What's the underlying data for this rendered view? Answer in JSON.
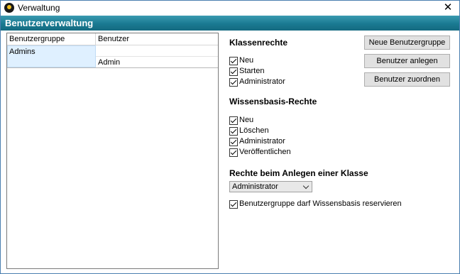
{
  "window": {
    "title": "Verwaltung",
    "close_glyph": "✕"
  },
  "header": {
    "title": "Benutzerverwaltung"
  },
  "tree": {
    "columns": [
      "Benutzergruppe",
      "Benutzer"
    ],
    "group": "Admins",
    "user": "Admin"
  },
  "klassenrechte": {
    "heading": "Klassenrechte",
    "items": [
      {
        "label": "Neu",
        "checked": true
      },
      {
        "label": "Starten",
        "checked": true
      },
      {
        "label": "Administrator",
        "checked": true
      }
    ]
  },
  "wissensbasis": {
    "heading": "Wissensbasis-Rechte",
    "items": [
      {
        "label": "Neu",
        "checked": true
      },
      {
        "label": "Löschen",
        "checked": true
      },
      {
        "label": "Administrator",
        "checked": true
      },
      {
        "label": "Veröffentlichen",
        "checked": true
      }
    ]
  },
  "anlegen": {
    "heading": "Rechte beim Anlegen einer Klasse",
    "selected": "Administrator"
  },
  "reservieren": {
    "label": "Benutzergruppe darf Wissensbasis reservieren",
    "checked": true
  },
  "buttons": {
    "neue_gruppe": "Neue Benutzergruppe",
    "anlegen": "Benutzer anlegen",
    "zuordnen": "Benutzer zuordnen"
  },
  "colors": {
    "header": "#1a7a92",
    "selection": "#dff0ff"
  }
}
